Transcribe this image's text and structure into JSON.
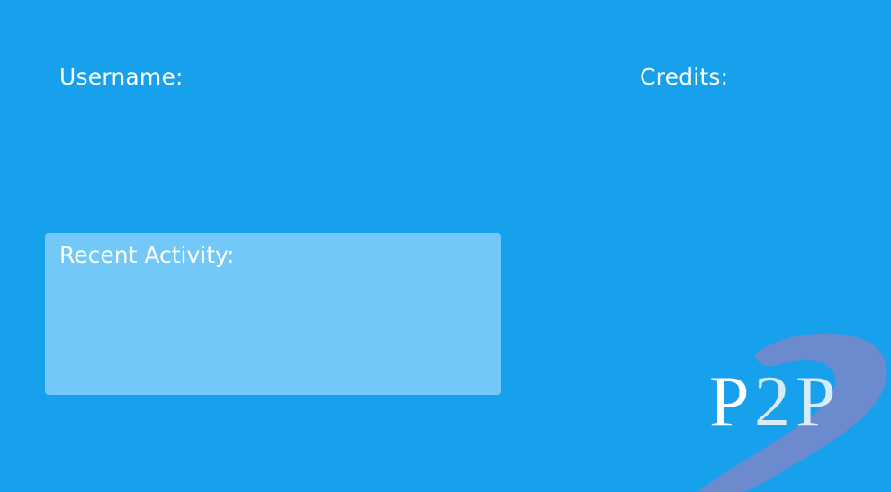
{
  "header": {
    "username_label": "Username:",
    "credits_label": "Credits:"
  },
  "activity": {
    "title": "Recent Activity:"
  },
  "logo": {
    "text": "P2P"
  },
  "colors": {
    "background": "#17a0ec",
    "panel": "#72c8f7",
    "text": "#ffffff",
    "logo_swoosh": "#7b86c9"
  }
}
